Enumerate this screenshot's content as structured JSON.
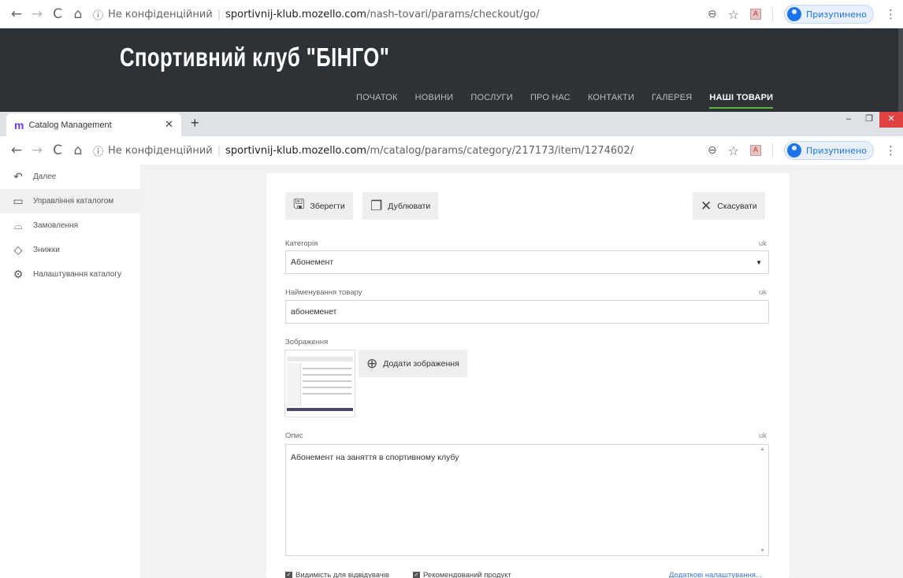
{
  "chrome1": {
    "security": "Не конфіденційний",
    "host": "sportivnij-klub.mozello.com",
    "path": "/nash-tovari/params/checkout/go/",
    "profile": "Призупинено"
  },
  "site": {
    "title": "Спортивний клуб \"БІНГО\"",
    "nav": [
      "ПОЧАТОК",
      "НОВИНИ",
      "ПОСЛУГИ",
      "ПРО НАС",
      "КОНТАКТИ",
      "ГАЛЕРЕЯ",
      "НАШІ ТОВАРИ"
    ]
  },
  "tabs": {
    "title": "Catalog Management",
    "logo": "m",
    "new_tab": "+"
  },
  "chrome2": {
    "security": "Не конфіденційний",
    "host": "sportivnij-klub.mozello.com",
    "path": "/m/catalog/params/category/217173/item/1274602/",
    "profile": "Призупинено"
  },
  "sidebar": {
    "items": [
      {
        "label": "Далее",
        "icon": "back-arrow-icon"
      },
      {
        "label": "Управління каталогом",
        "icon": "folder-icon"
      },
      {
        "label": "Замовлення",
        "icon": "basket-icon"
      },
      {
        "label": "Знижки",
        "icon": "tag-icon"
      },
      {
        "label": "Налаштування каталогу",
        "icon": "gear-icon"
      }
    ]
  },
  "toolbar": {
    "save": "Зберегти",
    "duplicate": "Дублювати",
    "cancel": "Скасувати"
  },
  "form": {
    "category_label": "Категорія",
    "category_value": "Абонемент",
    "name_label": "Найменування товару",
    "name_value": "абонеменет",
    "images_label": "Зображення",
    "add_image": "Додати зображення",
    "description_label": "Опис",
    "description_value": "Абонемент на заняття в спортивному клубу",
    "lang": "uk",
    "visible_label": "Видимість для відвідувачів",
    "recommended_label": "Рекомендований продукт",
    "more_settings": "Додаткові налаштування..."
  }
}
